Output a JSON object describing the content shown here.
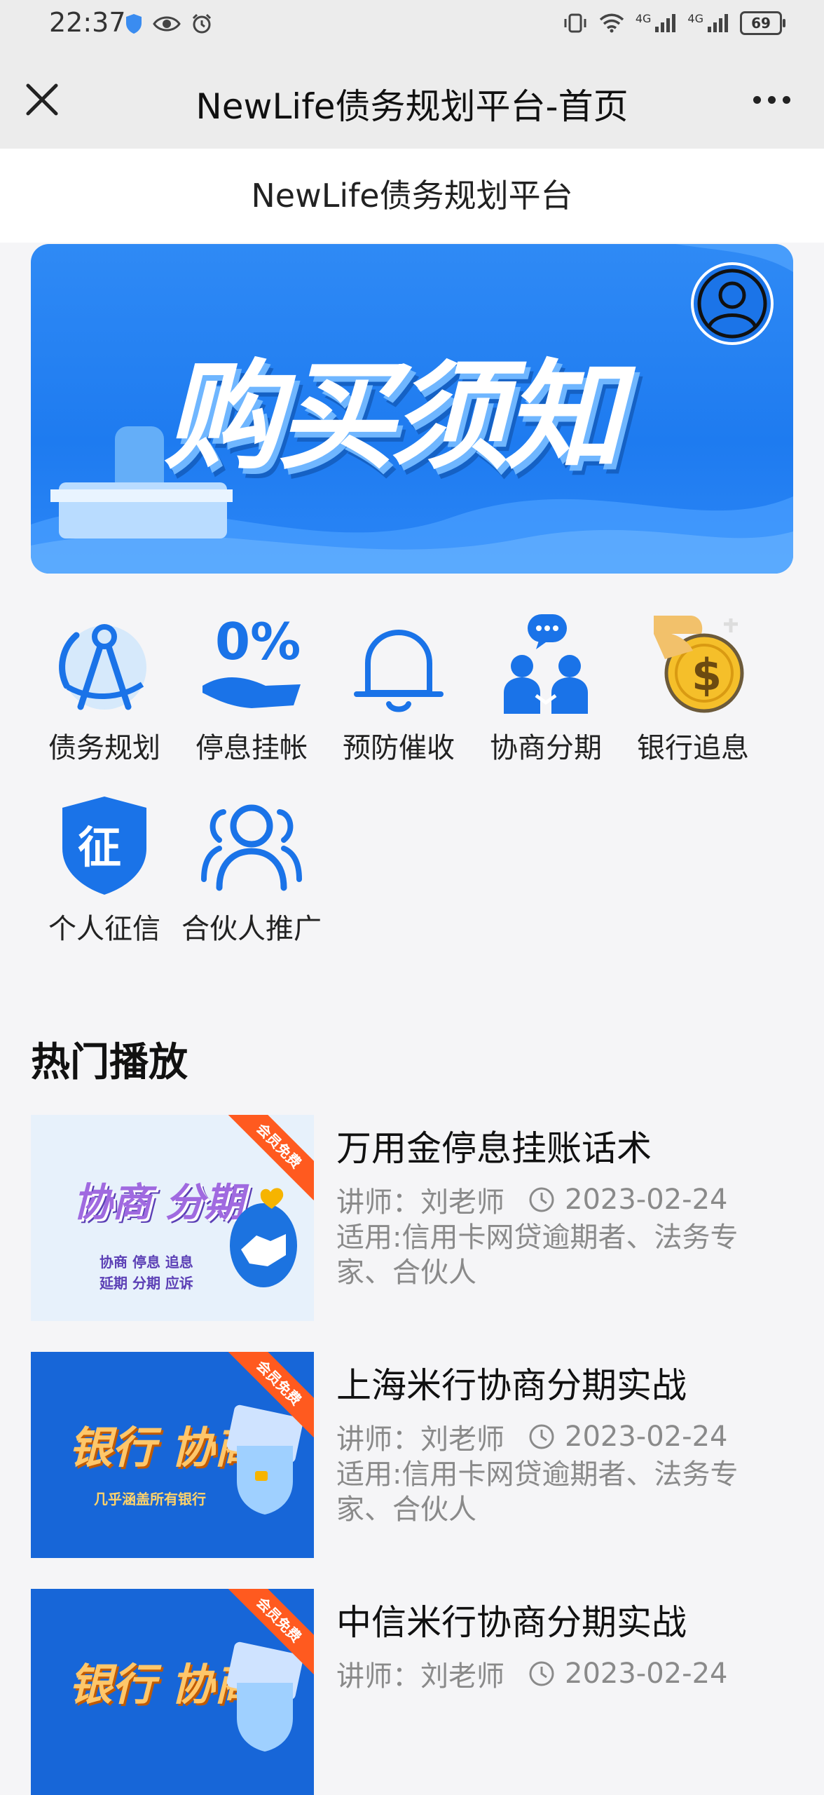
{
  "status_bar": {
    "time": "22:37",
    "battery": "69",
    "network1": "4G",
    "network2": "4G"
  },
  "nav": {
    "title": "NewLife债务规划平台-首页"
  },
  "subheader": {
    "title": "NewLife债务规划平台"
  },
  "banner": {
    "text": "购买须知"
  },
  "grid": [
    {
      "label": "债务规划",
      "icon": "compass-icon"
    },
    {
      "label": "停息挂帐",
      "icon": "zero-percent-hand-icon"
    },
    {
      "label": "预防催收",
      "icon": "bell-icon"
    },
    {
      "label": "协商分期",
      "icon": "negotiation-people-icon"
    },
    {
      "label": "银行追息",
      "icon": "coin-hand-icon"
    },
    {
      "label": "个人征信",
      "icon": "credit-shield-icon",
      "glyph": "征"
    },
    {
      "label": "合伙人推广",
      "icon": "partners-icon"
    }
  ],
  "section": {
    "title": "热门播放"
  },
  "courses": [
    {
      "title": "万用金停息挂账话术",
      "teacher": "讲师：刘老师",
      "date": "2023-02-24",
      "desc": "适用:信用卡网贷逾期者、法务专家、合伙人",
      "thumb_title": "协商 分期",
      "thumb_line1": "协商 停息 追息",
      "thumb_line2": "延期 分期 应诉",
      "ribbon": "会员免费"
    },
    {
      "title": "上海米行协商分期实战",
      "teacher": "讲师：刘老师",
      "date": "2023-02-24",
      "desc": "适用:信用卡网贷逾期者、法务专家、合伙人",
      "thumb_title": "银行 协商",
      "thumb_line1": "几乎涵盖所有银行",
      "ribbon": "会员免费"
    },
    {
      "title": "中信米行协商分期实战",
      "teacher": "讲师：刘老师",
      "date": "2023-02-24",
      "thumb_title": "银行 协商",
      "ribbon": "会员免费"
    }
  ]
}
